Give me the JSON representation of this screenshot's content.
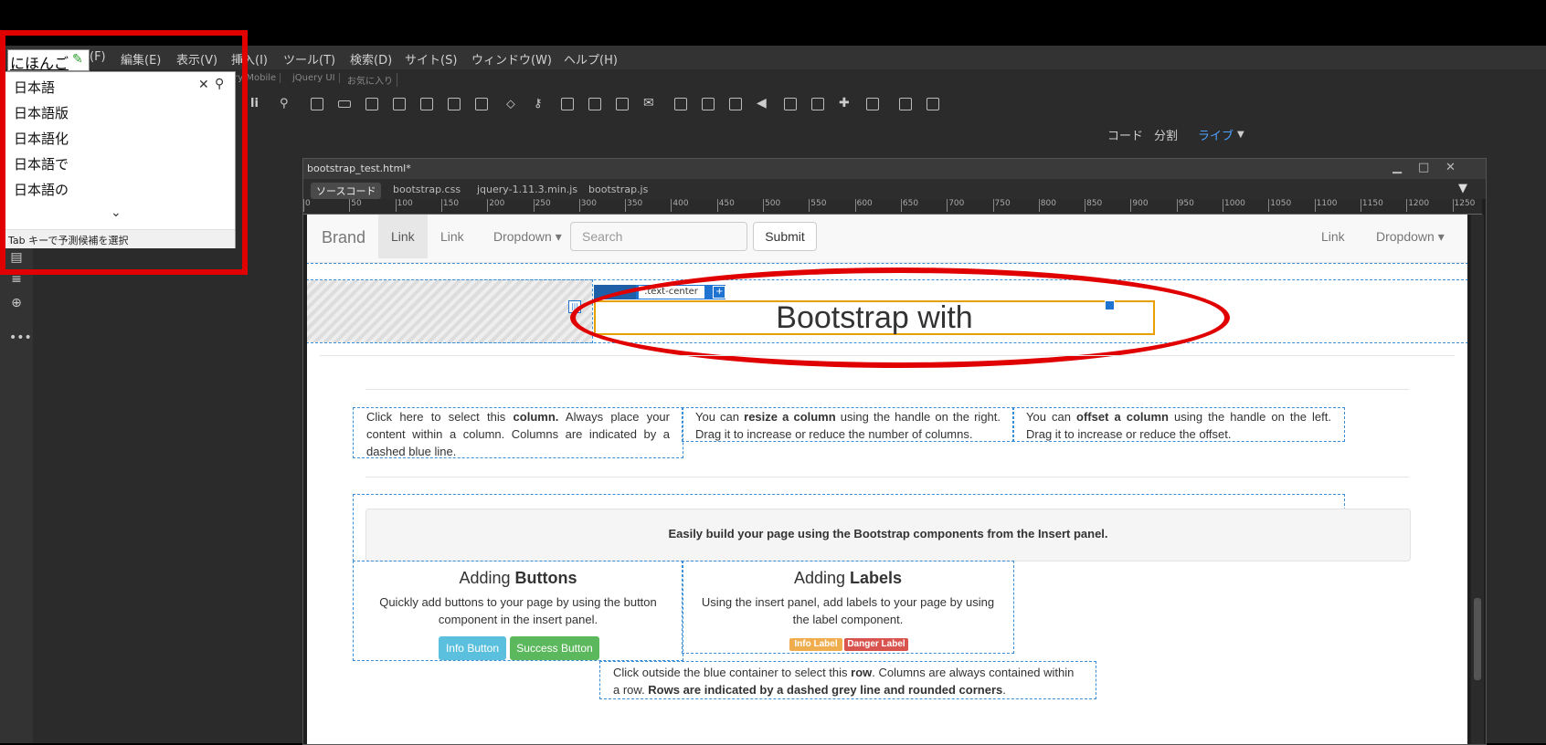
{
  "menu": [
    "(F)",
    "編集(E)",
    "表示(V)",
    "挿入(I)",
    "ツール(T)",
    "検索(D)",
    "サイト(S)",
    "ウィンドウ(W)",
    "ヘルプ(H)"
  ],
  "subtabs": [
    "ery Mobile",
    "jQuery UI",
    "お気に入り"
  ],
  "view_modes": {
    "code": "コード",
    "split": "分割",
    "live": "ライブ"
  },
  "document": {
    "title": "bootstrap_test.html*",
    "file_tabs": [
      "ソースコード",
      "bootstrap.css",
      "jquery-1.11.3.min.js",
      "bootstrap.js"
    ],
    "ruler": [
      "0",
      "50",
      "100",
      "150",
      "200",
      "250",
      "300",
      "350",
      "400",
      "450",
      "500",
      "550",
      "600",
      "650",
      "700",
      "750",
      "800",
      "850",
      "900",
      "950",
      "1000",
      "1050",
      "1100",
      "1150",
      "1200",
      "1250"
    ]
  },
  "navbar": {
    "brand": "Brand",
    "link1": "Link",
    "link2": "Link",
    "dropdown": "Dropdown",
    "search_placeholder": "Search",
    "submit": "Submit",
    "right_link": "Link",
    "right_dropdown": "Dropdown"
  },
  "element_tag": ".text-center",
  "heading": "Bootstrap with",
  "columns": {
    "col1": {
      "pre": "Click here to select this ",
      "bold": "column.",
      "post": " Always place your content within a column. Columns are indicated by a dashed blue line."
    },
    "col2": {
      "pre": "You can ",
      "bold": "resize a column",
      "post": " using the handle on the right. Drag it to increase or reduce the number of columns."
    },
    "col3": {
      "pre": "You can ",
      "bold": "offset a column",
      "post": " using the handle on the left. Drag it to increase or reduce the offset."
    }
  },
  "well_text": "Easily build your page using the Bootstrap components from the Insert panel.",
  "buttons_section": {
    "heading_pre": "Adding ",
    "heading_bold": "Buttons",
    "text": "Quickly add buttons to your page by using the button component in the insert panel.",
    "info_button": "Info Button",
    "success_button": "Success Button"
  },
  "labels_section": {
    "heading_pre": "Adding ",
    "heading_bold": "Labels",
    "text": "Using the insert panel, add labels to your page by using the label component.",
    "info_label": "Info Label",
    "danger_label": "Danger Label"
  },
  "row_note": {
    "pre": "Click outside the blue container to select this ",
    "bold1": "row",
    "mid": ". Columns are always contained within a row. ",
    "bold2": "Rows are indicated by a dashed grey line and rounded corners",
    "post": "."
  },
  "ime": {
    "composition": "にほんご",
    "candidates": [
      "日本語",
      "日本語版",
      "日本語化",
      "日本語で",
      "日本語の"
    ],
    "footer": "Tab キーで予測候補を選択"
  },
  "colors": {
    "annotation": "#e00000",
    "info": "#5bc0de",
    "success": "#5cb85c",
    "warning": "#f0ad4e",
    "danger": "#d9534f",
    "selection": "#e8a000"
  }
}
